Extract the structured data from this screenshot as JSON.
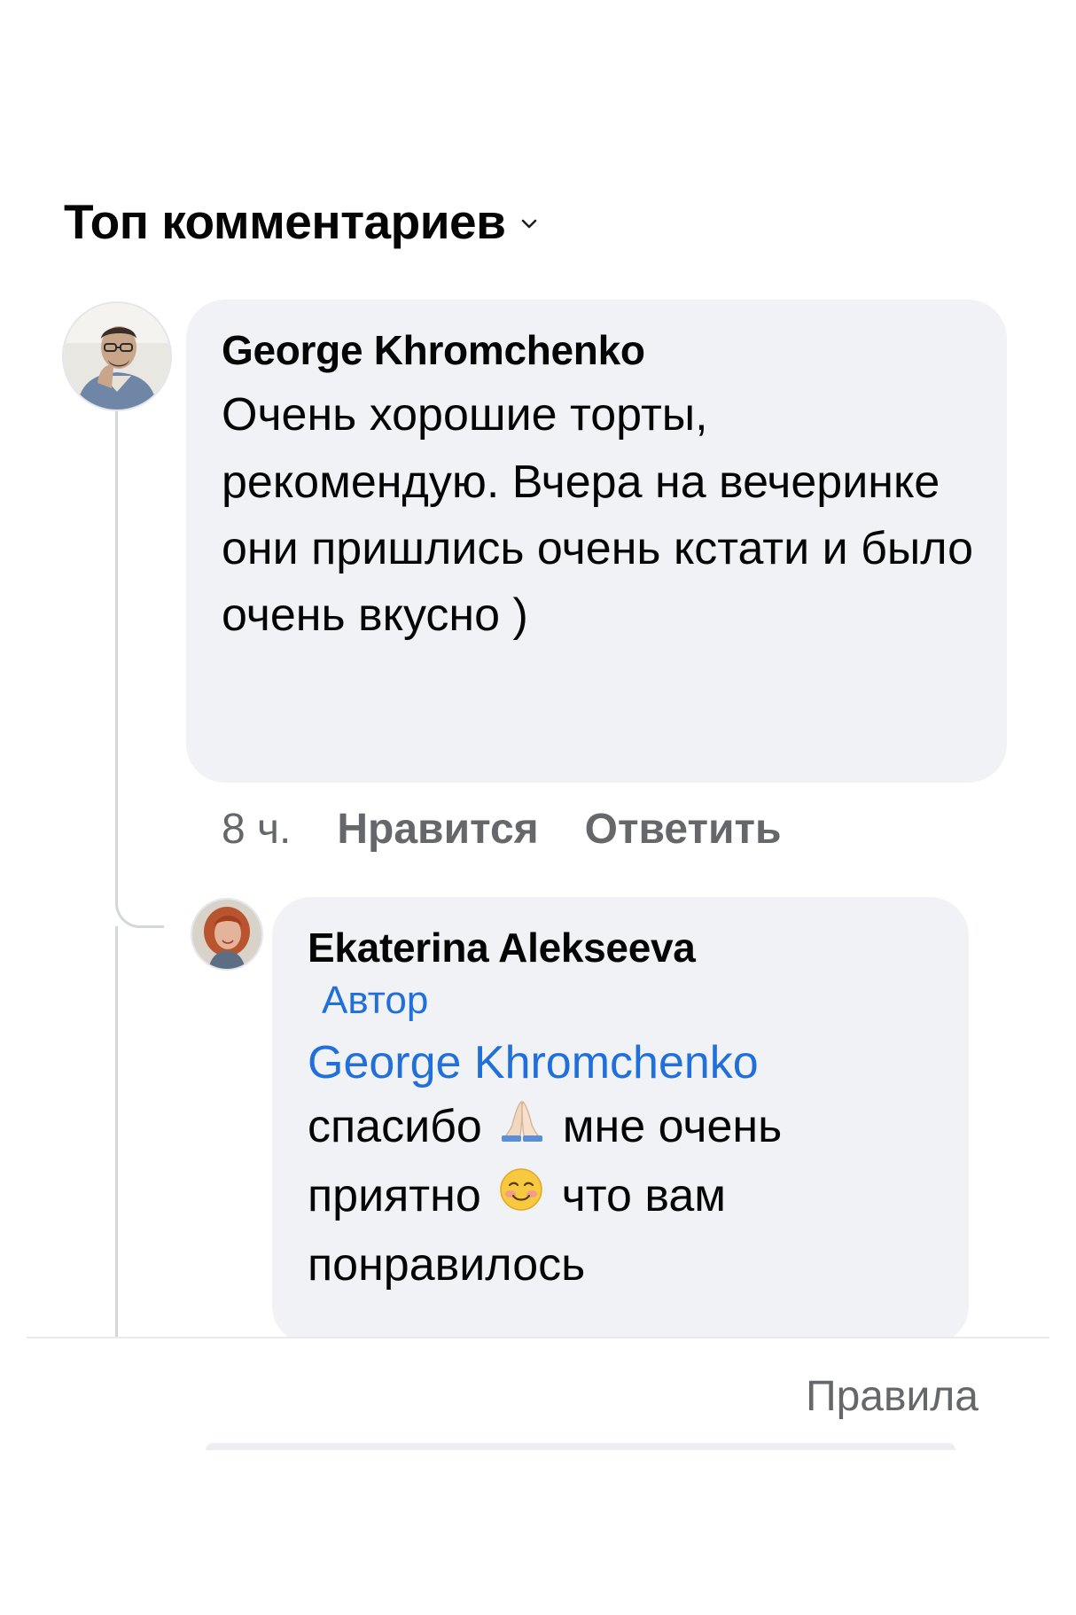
{
  "header": {
    "filter_label": "Топ комментариев",
    "filter_icon": "chevron-down-icon"
  },
  "comments": [
    {
      "author": "George Khromchenko",
      "text": "Очень хорошие торты, рекомендую. Вчера на вечеринке  они пришлись очень кстати и было очень вкусно )",
      "time": "8 ч.",
      "like_label": "Нравится",
      "reply_label": "Ответить",
      "avatar_icon": "avatar-man-glasses"
    }
  ],
  "replies": [
    {
      "author": "Ekaterina Alekseeva",
      "badge": "Автор",
      "mention": "George Khromchenko",
      "text_part1": "спасибо",
      "emoji1": "folded-hands-emoji",
      "text_part2": "мне очень приятно",
      "emoji2": "smiling-face-emoji",
      "text_part3": "что вам понравилось",
      "avatar_icon": "avatar-woman-red-hair"
    }
  ],
  "footer": {
    "rules_label": "Правила"
  },
  "colors": {
    "bubble": "#f0f2f5",
    "link_blue": "#216fdb",
    "meta_gray": "#65676b",
    "thread_line": "#d3d6db"
  }
}
